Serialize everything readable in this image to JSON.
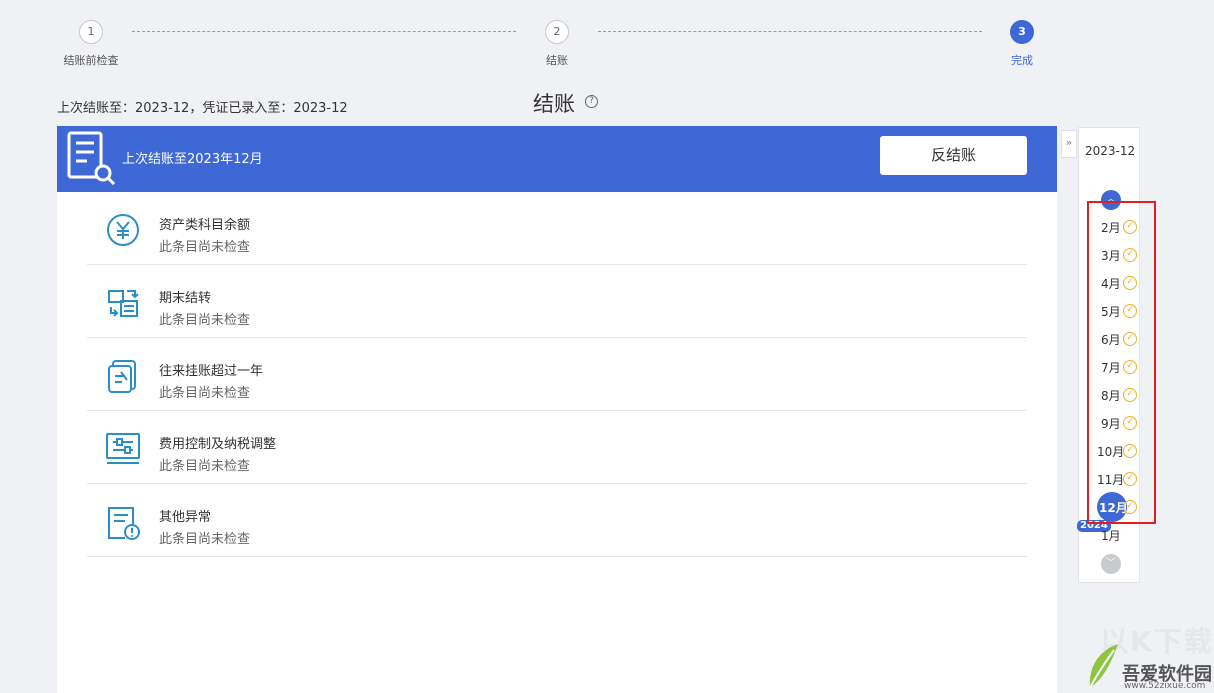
{
  "stepper": {
    "steps": [
      {
        "num": "1",
        "label": "结账前检查"
      },
      {
        "num": "2",
        "label": "结账"
      },
      {
        "num": "3",
        "label": "完成"
      }
    ]
  },
  "summary": "上次结账至：2023-12，凭证已录入至：2023-12",
  "page_title": "结账",
  "help_icon": "?",
  "banner": {
    "text": "上次结账至2023年12月",
    "button_label": "反结账"
  },
  "checks": [
    {
      "title": "资产类科目余额",
      "status": "此条目尚未检查",
      "icon": "yen-circle-icon"
    },
    {
      "title": "期末结转",
      "status": "此条目尚未检查",
      "icon": "transfer-icon"
    },
    {
      "title": "往来挂账超过一年",
      "status": "此条目尚未检查",
      "icon": "document-edit-icon"
    },
    {
      "title": "费用控制及纳税调整",
      "status": "此条目尚未检查",
      "icon": "sliders-monitor-icon"
    },
    {
      "title": "其他异常",
      "status": "此条目尚未检查",
      "icon": "document-warning-icon"
    }
  ],
  "month_panel": {
    "collapse": "»",
    "period": "2023-12",
    "months": [
      "2月",
      "3月",
      "4月",
      "5月",
      "6月",
      "7月",
      "8月",
      "9月",
      "10月",
      "11月",
      "12月"
    ],
    "selected_month": "12月",
    "next_year_badge": "2024",
    "next_month": "1月"
  },
  "watermark": {
    "top_text": "以K下载",
    "name": "吾爱软件园",
    "url": "www.52zixue.com"
  },
  "colors": {
    "primary": "#3d68d6",
    "check": "#e9b22e",
    "highlight": "#e02020"
  }
}
